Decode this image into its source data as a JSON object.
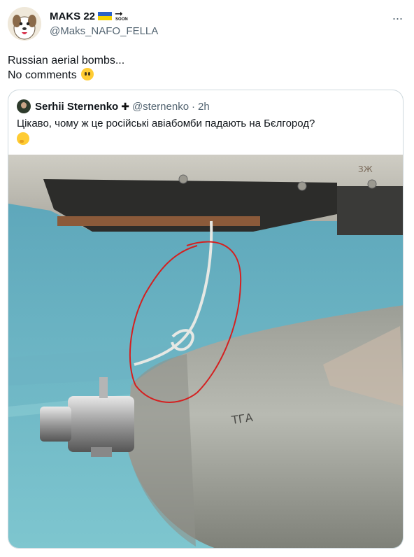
{
  "tweet": {
    "display_name": "MAKS 22",
    "name_flag_icon": "ukraine-flag-icon",
    "name_badge_text": "SOON",
    "handle": "@Maks_NAFO_FELLA",
    "more_icon": "more-icon",
    "text_line1": "Russian aerial bombs...",
    "text_line2": "No comments",
    "text_emoji": "face-without-mouth-emoji"
  },
  "quote": {
    "display_name": "Serhii Sternenko",
    "name_badge_icon": "cross-icon",
    "handle": "@sternenko",
    "separator": "·",
    "time": "2h",
    "text": "Цікаво, чому ж це російські авіабомби падають на Бєлгород?",
    "text_emoji": "thinking-face-emoji"
  },
  "media": {
    "description_icon": "photo-bomb-under-aircraft",
    "stencil_text": "ТГА",
    "panel_text": "ЗЖ"
  },
  "colors": {
    "handle_gray": "#536471",
    "border": "#cfd9de",
    "annotation_red": "#d42020"
  }
}
